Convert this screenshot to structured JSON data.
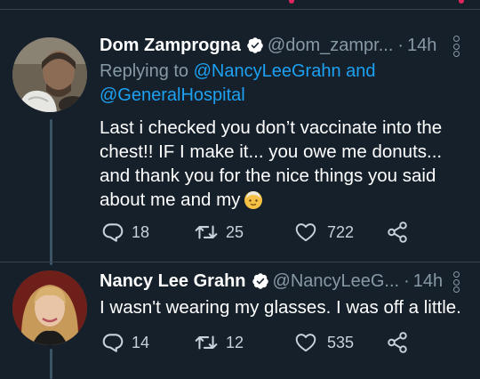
{
  "tweets": [
    {
      "author_name": "Dom Zamprogna",
      "handle": "@dom_zampr...",
      "separator": "·",
      "time": "14h",
      "replying_prefix": "Replying to",
      "reply_to_1": "@NancyLeeGrahn",
      "reply_and": "and",
      "reply_to_2": "@GeneralHospital",
      "text": "Last  i checked you don’t vaccinate into the chest!!  IF I make it...  you owe me donuts... and thank you for the nice things you said about me and my",
      "emoji_icon": "older-person-emoji-icon",
      "replies": "18",
      "retweets": "25",
      "likes": "722"
    },
    {
      "author_name": "Nancy Lee Grahn",
      "handle": "@NancyLeeG...",
      "separator": "·",
      "time": "14h",
      "text": "I wasn't wearing my glasses. I was off a little.",
      "replies": "14",
      "retweets": "12",
      "likes": "535"
    }
  ],
  "colors": {
    "background": "#15202b",
    "secondary_text": "#8899a6",
    "link": "#1da1f2",
    "verified": "#ffffff",
    "divider": "#38444d"
  }
}
